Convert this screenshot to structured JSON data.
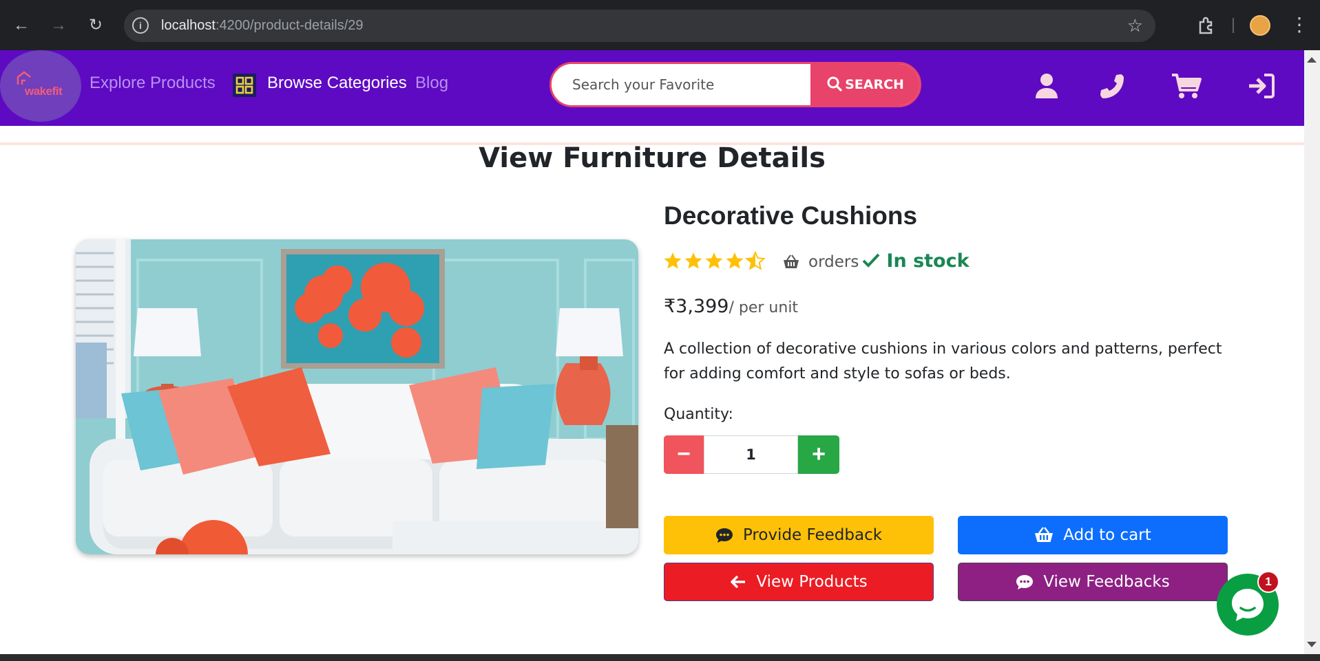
{
  "browser": {
    "url_host": "localhost",
    "url_path": ":4200/product-details/29"
  },
  "navbar": {
    "logo_text": "wakefit",
    "links": {
      "explore": "Explore Products",
      "browse": "Browse Categories",
      "blog": "Blog"
    },
    "search": {
      "placeholder": "Search your Favorite",
      "button_label": "SEARCH"
    },
    "icons": [
      "user-icon",
      "phone-icon",
      "cart-icon",
      "sign-in-icon"
    ]
  },
  "page": {
    "title": "View Furniture Details"
  },
  "product": {
    "name": "Decorative Cushions",
    "rating": 4.5,
    "orders_label": "orders",
    "stock_label": "In stock",
    "price": "₹3,399",
    "price_unit": "/ per unit",
    "description": "A collection of decorative cushions in various colors and patterns, perfect for adding comfort and style to sofas or beds.",
    "quantity_label": "Quantity:",
    "quantity": "1"
  },
  "actions": {
    "feedback": "Provide Feedback",
    "add_to_cart": "Add to cart",
    "view_products": "View Products",
    "view_feedbacks": "View Feedbacks"
  },
  "chat": {
    "badge_count": "1"
  },
  "colors": {
    "nav_bg": "#5e0ac3",
    "search_accent": "#e8436a",
    "stock_green": "#198754",
    "star": "#ffc107",
    "btn_feedback": "#ffc107",
    "btn_cart": "#0d6efd",
    "btn_products": "#ec1c24",
    "btn_feedbacks": "#8e2083",
    "chat": "#0a9e43"
  }
}
